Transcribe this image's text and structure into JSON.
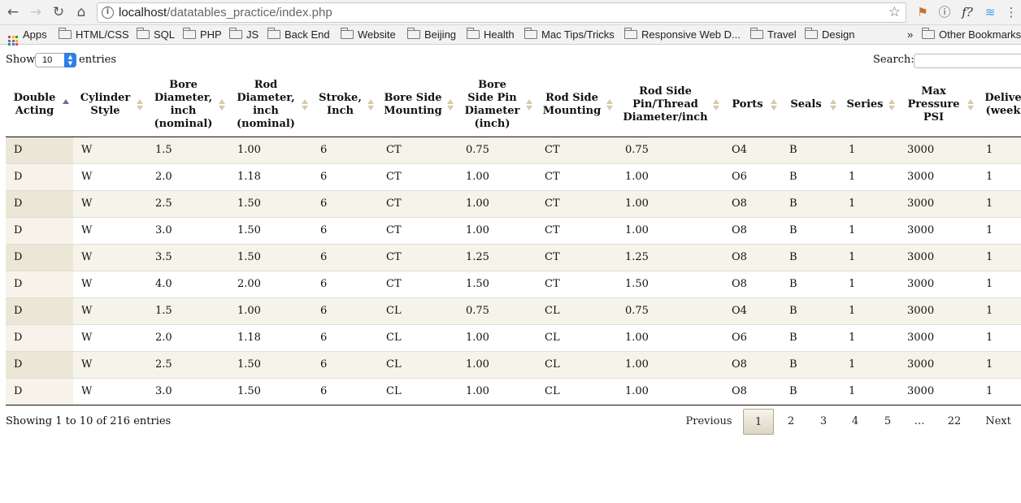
{
  "browser": {
    "url_host": "localhost",
    "url_path": "/datatables_practice/index.php",
    "bookmarks": [
      "Apps",
      "HTML/CSS",
      "SQL",
      "PHP",
      "JS",
      "Back End",
      "Website",
      "Beijing",
      "Health",
      "Mac Tips/Tricks",
      "Responsive Web D...",
      "Travel",
      "Design"
    ],
    "bookmarks_overflow": "»",
    "other_bookmarks": "Other Bookmarks",
    "extensions": [
      "f?"
    ]
  },
  "table_controls": {
    "show_label": "Show",
    "entries_label": "entries",
    "page_length": "10",
    "search_label": "Search:"
  },
  "columns": [
    {
      "line1": "Double",
      "line2": "Acting",
      "line3": "",
      "line4": ""
    },
    {
      "line1": "Cylinder",
      "line2": "Style",
      "line3": "",
      "line4": ""
    },
    {
      "line1": "Bore",
      "line2": "Diameter,",
      "line3": "inch",
      "line4": "(nominal)"
    },
    {
      "line1": "Rod",
      "line2": "Diameter,",
      "line3": "inch",
      "line4": "(nominal)"
    },
    {
      "line1": "Stroke,",
      "line2": "Inch",
      "line3": "",
      "line4": ""
    },
    {
      "line1": "Bore Side",
      "line2": "Mounting",
      "line3": "",
      "line4": ""
    },
    {
      "line1": "Bore",
      "line2": "Side Pin",
      "line3": "Diameter",
      "line4": "(inch)"
    },
    {
      "line1": "Rod Side",
      "line2": "Mounting",
      "line3": "",
      "line4": ""
    },
    {
      "line1": "Rod Side",
      "line2": "Pin/Thread",
      "line3": "Diameter/inch",
      "line4": ""
    },
    {
      "line1": "Ports",
      "line2": "",
      "line3": "",
      "line4": ""
    },
    {
      "line1": "Seals",
      "line2": "",
      "line3": "",
      "line4": ""
    },
    {
      "line1": "Series",
      "line2": "",
      "line3": "",
      "line4": ""
    },
    {
      "line1": "Max",
      "line2": "Pressure",
      "line3": "PSI",
      "line4": ""
    },
    {
      "line1": "Delive",
      "line2": "(week",
      "line3": "",
      "line4": ""
    }
  ],
  "sorted_column": "Double Acting",
  "rows": [
    [
      "D",
      "W",
      "1.5",
      "1.00",
      "6",
      "CT",
      "0.75",
      "CT",
      "0.75",
      "O4",
      "B",
      "1",
      "3000",
      "1"
    ],
    [
      "D",
      "W",
      "2.0",
      "1.18",
      "6",
      "CT",
      "1.00",
      "CT",
      "1.00",
      "O6",
      "B",
      "1",
      "3000",
      "1"
    ],
    [
      "D",
      "W",
      "2.5",
      "1.50",
      "6",
      "CT",
      "1.00",
      "CT",
      "1.00",
      "O8",
      "B",
      "1",
      "3000",
      "1"
    ],
    [
      "D",
      "W",
      "3.0",
      "1.50",
      "6",
      "CT",
      "1.00",
      "CT",
      "1.00",
      "O8",
      "B",
      "1",
      "3000",
      "1"
    ],
    [
      "D",
      "W",
      "3.5",
      "1.50",
      "6",
      "CT",
      "1.25",
      "CT",
      "1.25",
      "O8",
      "B",
      "1",
      "3000",
      "1"
    ],
    [
      "D",
      "W",
      "4.0",
      "2.00",
      "6",
      "CT",
      "1.50",
      "CT",
      "1.50",
      "O8",
      "B",
      "1",
      "3000",
      "1"
    ],
    [
      "D",
      "W",
      "1.5",
      "1.00",
      "6",
      "CL",
      "0.75",
      "CL",
      "0.75",
      "O4",
      "B",
      "1",
      "3000",
      "1"
    ],
    [
      "D",
      "W",
      "2.0",
      "1.18",
      "6",
      "CL",
      "1.00",
      "CL",
      "1.00",
      "O6",
      "B",
      "1",
      "3000",
      "1"
    ],
    [
      "D",
      "W",
      "2.5",
      "1.50",
      "6",
      "CL",
      "1.00",
      "CL",
      "1.00",
      "O8",
      "B",
      "1",
      "3000",
      "1"
    ],
    [
      "D",
      "W",
      "3.0",
      "1.50",
      "6",
      "CL",
      "1.00",
      "CL",
      "1.00",
      "O8",
      "B",
      "1",
      "3000",
      "1"
    ]
  ],
  "footer": {
    "info": "Showing 1 to 10 of 216 entries",
    "previous": "Previous",
    "pages": [
      "1",
      "2",
      "3",
      "4",
      "5",
      "…",
      "22"
    ],
    "current_page": "1",
    "next": "Next"
  }
}
